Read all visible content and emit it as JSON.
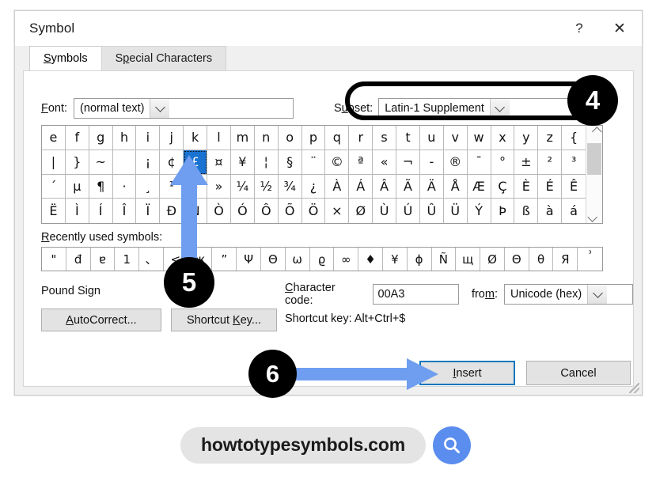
{
  "window": {
    "title": "Symbol",
    "help_icon": "?",
    "close_icon": "✕"
  },
  "tabs": [
    {
      "label": "Symbols",
      "underline_index": 0,
      "active": true
    },
    {
      "label": "Special Characters",
      "underline_index": 9,
      "active": false
    }
  ],
  "font": {
    "label": "Font:",
    "value": "(normal text)"
  },
  "subset": {
    "label": "Subset:",
    "value": "Latin-1 Supplement"
  },
  "grid": {
    "columns": 23,
    "rows": 4,
    "selected_index": 29,
    "cells": [
      "e",
      "f",
      "g",
      "h",
      "i",
      "j",
      "k",
      "l",
      "m",
      "n",
      "o",
      "p",
      "q",
      "r",
      "s",
      "t",
      "u",
      "v",
      "w",
      "x",
      "y",
      "z",
      "{",
      "|",
      "}",
      "~",
      "",
      "¡",
      "¢",
      "£",
      "¤",
      "¥",
      "¦",
      "§",
      "¨",
      "©",
      "ª",
      "«",
      "¬",
      "-",
      "®",
      "¯",
      "°",
      "±",
      "²",
      "³",
      "´",
      "µ",
      "¶",
      "·",
      "¸",
      "¹",
      "º",
      "»",
      "¼",
      "½",
      "¾",
      "¿",
      "À",
      "Á",
      "Â",
      "Ã",
      "Ä",
      "Å",
      "Æ",
      "Ç",
      "È",
      "É",
      "Ê",
      "Ë",
      "Ì",
      "Í",
      "Î",
      "Ï",
      "Ð",
      "Ñ",
      "Ò",
      "Ó",
      "Ô",
      "Õ",
      "Ö",
      "×",
      "Ø",
      "Ù",
      "Ú",
      "Û",
      "Ü",
      "Ý",
      "Þ",
      "ß",
      "à",
      "á"
    ]
  },
  "scrollbar": {
    "up_icon": "chevron-up-icon",
    "down_icon": "chevron-down-icon"
  },
  "recent": {
    "label": "Recently used symbols:",
    "cells": [
      "\"",
      "đ",
      "ɐ",
      "1",
      "、",
      "<",
      "ж",
      "”",
      "Ψ",
      "Θ",
      "ω",
      "ϱ",
      "∞",
      "♦",
      "¥",
      "ϕ",
      "Ñ",
      "щ",
      "Ø",
      "Θ",
      "θ",
      "Я",
      "³"
    ]
  },
  "symbol_name": "Pound Sign",
  "character_code": {
    "label": "Character code:",
    "value": "00A3"
  },
  "from": {
    "label": "from:",
    "value": "Unicode (hex)"
  },
  "buttons": {
    "autocorrect": "AutoCorrect...",
    "shortcut_key": "Shortcut Key...",
    "insert": "Insert",
    "cancel": "Cancel"
  },
  "shortcut_text": "Shortcut key: Alt+Ctrl+$",
  "annotations": {
    "step4": "4",
    "step5": "5",
    "step6": "6",
    "arrow_color": "#6f9ef0",
    "box_color": "#000000",
    "circle_color": "#000000"
  },
  "watermark": {
    "text": "howtotypesymbols.com",
    "icon": "search-icon",
    "pill_color": "#e4e4e4",
    "circle_color": "#5b8def"
  },
  "colors": {
    "selection_blue": "#1a73d0",
    "insert_focus_blue": "#0b77bd",
    "dialog_bg": "#f0f0f0"
  }
}
